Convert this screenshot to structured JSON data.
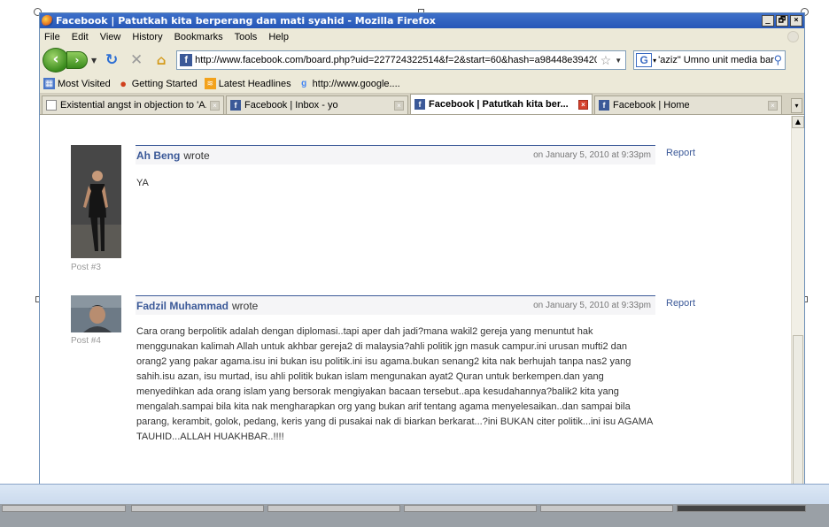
{
  "window": {
    "title": "Facebook | Patutkah kita berperang dan mati syahid - Mozilla Firefox",
    "controls": [
      "_",
      "🗗",
      "×"
    ]
  },
  "menu": [
    "File",
    "Edit",
    "View",
    "History",
    "Bookmarks",
    "Tools",
    "Help"
  ],
  "navigation": {
    "url": "http://www.facebook.com/board.php?uid=227724322514&f=2&start=60&hash=a98448e39420",
    "search_value": "'aziz\" Umno unit media baru",
    "search_engine_letter": "G"
  },
  "bookmarks": [
    {
      "label": "Most Visited",
      "icon": "most-visited-icon"
    },
    {
      "label": "Getting Started",
      "icon": "getting-started-icon"
    },
    {
      "label": "Latest Headlines",
      "icon": "rss-icon"
    },
    {
      "label": "http://www.google....",
      "icon": "google-icon"
    }
  ],
  "tabs": [
    {
      "label": "Existential angst in objection to 'A...",
      "icon": "document-icon",
      "active": false
    },
    {
      "label": "Facebook | Inbox - yo",
      "icon": "facebook-icon",
      "active": false
    },
    {
      "label": "Facebook | Patutkah kita ber...",
      "icon": "facebook-icon",
      "active": true
    },
    {
      "label": "Facebook | Home",
      "icon": "facebook-icon",
      "active": false
    }
  ],
  "posts": [
    {
      "author": "Ah Beng",
      "wrote": "wrote",
      "date": "on January 5, 2010 at 9:33pm",
      "post_number": "Post #3",
      "report": "Report",
      "body": "YA"
    },
    {
      "author": "Fadzil Muhammad",
      "wrote": "wrote",
      "date": "on January 5, 2010 at 9:33pm",
      "post_number": "Post #4",
      "report": "Report",
      "body": "Cara orang berpolitik adalah dengan diplomasi..tapi aper dah jadi?mana wakil2 gereja yang menuntut hak menggunakan kalimah Allah untuk akhbar gereja2 di malaysia?ahli politik jgn masuk campur.ini urusan mufti2 dan orang2 yang pakar agama.isu ini bukan isu politik.ini isu agama.bukan senang2 kita nak berhujah tanpa nas2 yang sahih.isu azan, isu murtad, isu ahli politik bukan islam mengunakan ayat2 Quran untuk berkempen.dan yang menyedihkan ada orang islam yang bersorak mengiyakan bacaan tersebut..apa kesudahannya?balik2 kita yang mengalah.sampai bila kita nak mengharapkan org yang bukan arif tentang agama menyelesaikan..dan sampai bila parang, kerambit, golok, pedang, keris yang di pusakai nak di biarkan berkarat...?ini BUKAN citer politik...ini isu AGAMA TAUHID...ALLAH HUAKHBAR..!!!!"
    }
  ],
  "colors": {
    "facebook_blue": "#3b5998",
    "titlebar": "#2657b8",
    "chrome": "#ece9d8"
  }
}
